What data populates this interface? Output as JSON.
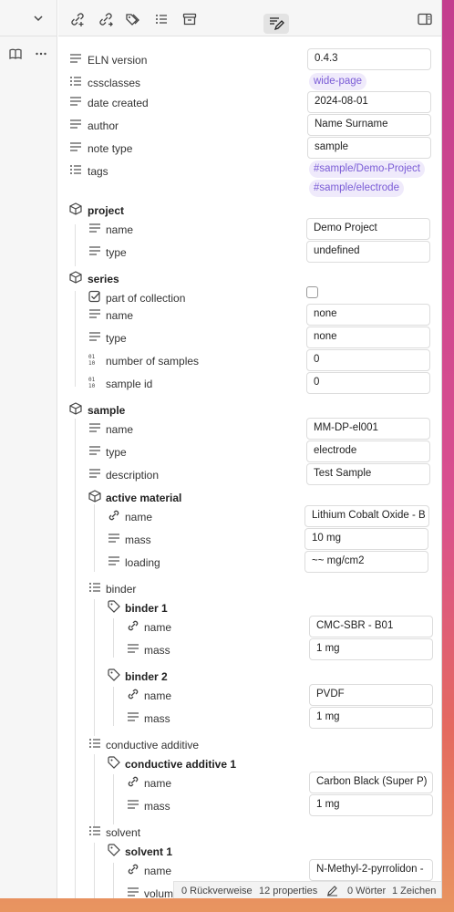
{
  "properties": [
    {
      "name": "ELN version",
      "value": "0.4.3"
    },
    {
      "name": "cssclasses",
      "value": "wide-page"
    },
    {
      "name": "date created",
      "value": "2024-08-01"
    },
    {
      "name": "author",
      "value": "Name Surname"
    },
    {
      "name": "note type",
      "value": "sample"
    },
    {
      "name": "tags",
      "values": [
        "#sample/Demo-Project",
        "#sample/electrode"
      ]
    }
  ],
  "project": {
    "label": "project",
    "name": {
      "label": "name",
      "value": "Demo Project"
    },
    "type": {
      "label": "type",
      "value": "undefined"
    }
  },
  "series": {
    "label": "series",
    "part_of_collection": {
      "label": "part of collection",
      "checked": false
    },
    "name": {
      "label": "name",
      "value": "none"
    },
    "type": {
      "label": "type",
      "value": "none"
    },
    "number_of_samples": {
      "label": "number of samples",
      "value": "0"
    },
    "sample_id": {
      "label": "sample id",
      "value": "0"
    }
  },
  "sample": {
    "label": "sample",
    "name": {
      "label": "name",
      "value": "MM-DP-el001"
    },
    "type": {
      "label": "type",
      "value": "electrode"
    },
    "description": {
      "label": "description",
      "value": "Test Sample"
    },
    "active_material": {
      "label": "active material",
      "name": {
        "label": "name",
        "value": "Lithium Cobalt Oxide - B"
      },
      "mass": {
        "label": "mass",
        "value": "10 mg"
      },
      "loading": {
        "label": "loading",
        "value": "~~ mg/cm2"
      }
    },
    "binder": {
      "label": "binder",
      "binder1": {
        "label": "binder 1",
        "name": {
          "label": "name",
          "value": "CMC-SBR - B01"
        },
        "mass": {
          "label": "mass",
          "value": "1 mg"
        }
      },
      "binder2": {
        "label": "binder 2",
        "name": {
          "label": "name",
          "value": "PVDF"
        },
        "mass": {
          "label": "mass",
          "value": "1 mg"
        }
      }
    },
    "conductive_additive": {
      "label": "conductive additive",
      "item1": {
        "label": "conductive additive 1",
        "name": {
          "label": "name",
          "value": "Carbon Black (Super P)"
        },
        "mass": {
          "label": "mass",
          "value": "1 mg"
        }
      }
    },
    "solvent": {
      "label": "solvent",
      "solvent1": {
        "label": "solvent 1",
        "name": {
          "label": "name",
          "value": "N-Methyl-2-pyrrolidon -"
        },
        "volume": {
          "label": "volume",
          "value": ""
        }
      }
    }
  },
  "statusbar": {
    "backlinks": "0 Rückverweise",
    "properties": "12 properties",
    "words": "0 Wörter",
    "chars": "1 Zeichen"
  },
  "icons": [
    "chevron-down-icon",
    "book-icon",
    "more-icon",
    "link-add-icon",
    "link-out-icon",
    "tags-icon",
    "list-icon",
    "archive-icon",
    "edit-active-icon",
    "sidebar-toggle-icon",
    "pencil-icon"
  ]
}
